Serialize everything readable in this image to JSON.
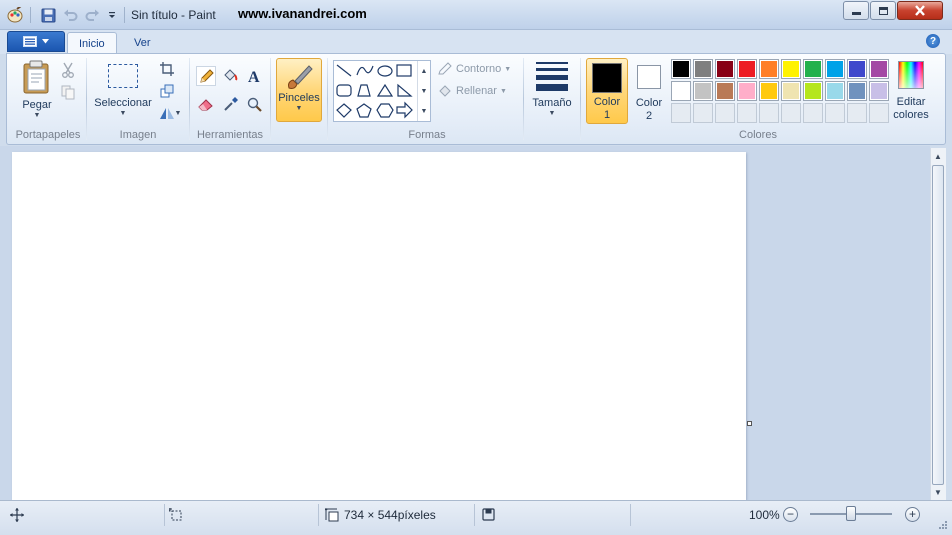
{
  "window": {
    "title": "Sin título - Paint",
    "watermark": "www.ivanandrei.com"
  },
  "tabs": {
    "inicio": "Inicio",
    "ver": "Ver"
  },
  "help": "?",
  "groups": {
    "portapapeles": "Portapapeles",
    "imagen": "Imagen",
    "herramientas": "Herramientas",
    "formas": "Formas",
    "colores": "Colores"
  },
  "buttons": {
    "pegar": "Pegar",
    "seleccionar": "Seleccionar",
    "pinceles": "Pinceles",
    "contorno": "Contorno",
    "rellenar": "Rellenar",
    "tamano": "Tamaño",
    "color1_line1": "Color",
    "color1_line2": "1",
    "color2_line1": "Color",
    "color2_line2": "2",
    "editar_line1": "Editar",
    "editar_line2": "colores"
  },
  "colors": {
    "color1": "#000000",
    "color2": "#ffffff",
    "palette_row1": [
      "#000000",
      "#7f7f7f",
      "#880015",
      "#ed1c24",
      "#ff7f27",
      "#fff200",
      "#22b14c",
      "#00a2e8",
      "#3f48cc",
      "#a349a4"
    ],
    "palette_row2": [
      "#ffffff",
      "#c3c3c3",
      "#b97a57",
      "#ffaec9",
      "#ffc90e",
      "#efe4b0",
      "#b5e61d",
      "#99d9ea",
      "#7092be",
      "#c8bfe7"
    ],
    "accent": "#ffd67a"
  },
  "status": {
    "image_size": "734 × 544píxeles",
    "zoom": "100%",
    "zoom_out": "−",
    "zoom_in": "+",
    "zoom_level_percent": 100
  }
}
